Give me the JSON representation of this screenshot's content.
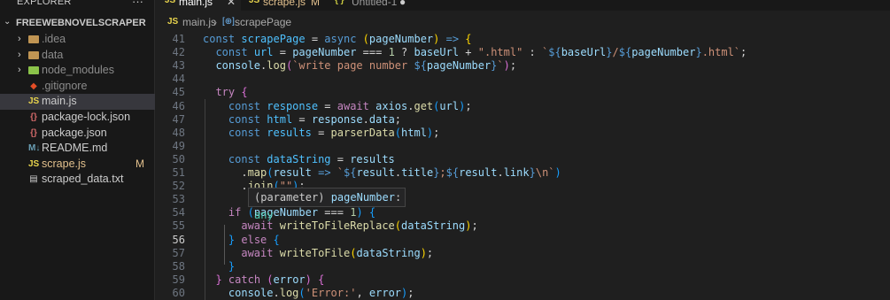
{
  "sidebar": {
    "title": "EXPLORER",
    "more": "···",
    "folder": {
      "chevron": "⌄",
      "name": "FREEWEBNOVELSCRAPER"
    },
    "items": [
      {
        "name": ".idea",
        "type": "folder",
        "icon": "folder-icon",
        "chevron": "›",
        "color": "gray",
        "iconColor": "#c09553"
      },
      {
        "name": "data",
        "type": "folder",
        "icon": "folder-icon",
        "chevron": "›",
        "color": "gray",
        "iconColor": "#c09553"
      },
      {
        "name": "node_modules",
        "type": "folder",
        "icon": "folder-icon",
        "chevron": "›",
        "color": "gray",
        "iconColor": "#8bc34a"
      },
      {
        "name": ".gitignore",
        "type": "file",
        "icon": "git-icon",
        "chevron": "",
        "color": "gray"
      },
      {
        "name": "main.js",
        "type": "file",
        "icon": "js-icon",
        "chevron": "",
        "color": "normal",
        "active": true
      },
      {
        "name": "package-lock.json",
        "type": "file",
        "icon": "json-icon",
        "chevron": "",
        "color": "normal"
      },
      {
        "name": "package.json",
        "type": "file",
        "icon": "json-icon",
        "chevron": "",
        "color": "normal"
      },
      {
        "name": "README.md",
        "type": "file",
        "icon": "markdown-icon",
        "chevron": "",
        "color": "normal"
      },
      {
        "name": "scrape.js",
        "type": "file",
        "icon": "js-icon",
        "chevron": "",
        "color": "modified",
        "badge": "M"
      },
      {
        "name": "scraped_data.txt",
        "type": "file",
        "icon": "text-file-icon",
        "chevron": "",
        "color": "normal"
      }
    ]
  },
  "tabs": [
    {
      "label": "main.js",
      "icon": "JS",
      "active": true,
      "close": "✕"
    },
    {
      "label": "scrape.js",
      "icon": "JS",
      "badge": "M",
      "active": false
    },
    {
      "label": "Untitled-1",
      "icon": "{ }",
      "dirty": "●",
      "active": false
    }
  ],
  "breadcrumb": {
    "file_icon": "JS",
    "file": "main.js",
    "sep": "›",
    "symbol_icon": "[⊕]",
    "symbol": "scrapePage"
  },
  "editor": {
    "current_line": 56,
    "lines": [
      {
        "n": 41,
        "tokens": [
          [
            "kw",
            "const "
          ],
          [
            "cst",
            "scrapePage"
          ],
          [
            "pn",
            " = "
          ],
          [
            "kw",
            "async "
          ],
          [
            "br1",
            "("
          ],
          [
            "var",
            "pageNumber"
          ],
          [
            "br1",
            ")"
          ],
          [
            "pn",
            " "
          ],
          [
            "kw",
            "=>"
          ],
          [
            "pn",
            " "
          ],
          [
            "br1",
            "{"
          ]
        ]
      },
      {
        "n": 42,
        "tokens": [
          [
            "pn",
            "  "
          ],
          [
            "kw",
            "const "
          ],
          [
            "cst",
            "url"
          ],
          [
            "pn",
            " = "
          ],
          [
            "var",
            "pageNumber"
          ],
          [
            "pn",
            " === "
          ],
          [
            "num",
            "1"
          ],
          [
            "pn",
            " ? "
          ],
          [
            "var",
            "baseUrl"
          ],
          [
            "pn",
            " + "
          ],
          [
            "str",
            "\".html\""
          ],
          [
            "pn",
            " : "
          ],
          [
            "str",
            "`"
          ],
          [
            "kw",
            "${"
          ],
          [
            "var",
            "baseUrl"
          ],
          [
            "kw",
            "}"
          ],
          [
            "str",
            "/"
          ],
          [
            "kw",
            "${"
          ],
          [
            "var",
            "pageNumber"
          ],
          [
            "kw",
            "}"
          ],
          [
            "str",
            ".html`"
          ],
          [
            "pn",
            ";"
          ]
        ]
      },
      {
        "n": 43,
        "tokens": [
          [
            "pn",
            "  "
          ],
          [
            "var",
            "console"
          ],
          [
            "pn",
            "."
          ],
          [
            "fn",
            "log"
          ],
          [
            "br2",
            "("
          ],
          [
            "str",
            "`write page number "
          ],
          [
            "kw",
            "${"
          ],
          [
            "var",
            "pageNumber"
          ],
          [
            "kw",
            "}"
          ],
          [
            "str",
            "`"
          ],
          [
            "br2",
            ")"
          ],
          [
            "pn",
            ";"
          ]
        ]
      },
      {
        "n": 44,
        "tokens": []
      },
      {
        "n": 45,
        "tokens": [
          [
            "pn",
            "  "
          ],
          [
            "ctl",
            "try"
          ],
          [
            "pn",
            " "
          ],
          [
            "br2",
            "{"
          ]
        ]
      },
      {
        "n": 46,
        "tokens": [
          [
            "pn",
            "    "
          ],
          [
            "kw",
            "const "
          ],
          [
            "cst",
            "response"
          ],
          [
            "pn",
            " = "
          ],
          [
            "ctl",
            "await "
          ],
          [
            "var",
            "axios"
          ],
          [
            "pn",
            "."
          ],
          [
            "fn",
            "get"
          ],
          [
            "br3",
            "("
          ],
          [
            "var",
            "url"
          ],
          [
            "br3",
            ")"
          ],
          [
            "pn",
            ";"
          ]
        ]
      },
      {
        "n": 47,
        "tokens": [
          [
            "pn",
            "    "
          ],
          [
            "kw",
            "const "
          ],
          [
            "cst",
            "html"
          ],
          [
            "pn",
            " = "
          ],
          [
            "var",
            "response"
          ],
          [
            "pn",
            "."
          ],
          [
            "var",
            "data"
          ],
          [
            "pn",
            ";"
          ]
        ]
      },
      {
        "n": 48,
        "tokens": [
          [
            "pn",
            "    "
          ],
          [
            "kw",
            "const "
          ],
          [
            "cst",
            "results"
          ],
          [
            "pn",
            " = "
          ],
          [
            "fn",
            "parserData"
          ],
          [
            "br3",
            "("
          ],
          [
            "var",
            "html"
          ],
          [
            "br3",
            ")"
          ],
          [
            "pn",
            ";"
          ]
        ]
      },
      {
        "n": 49,
        "tokens": []
      },
      {
        "n": 50,
        "tokens": [
          [
            "pn",
            "    "
          ],
          [
            "kw",
            "const "
          ],
          [
            "cst",
            "dataString"
          ],
          [
            "pn",
            " = "
          ],
          [
            "var",
            "results"
          ]
        ]
      },
      {
        "n": 51,
        "tokens": [
          [
            "pn",
            "      ."
          ],
          [
            "fn",
            "map"
          ],
          [
            "br3",
            "("
          ],
          [
            "var",
            "result"
          ],
          [
            "pn",
            " "
          ],
          [
            "kw",
            "=>"
          ],
          [
            "pn",
            " "
          ],
          [
            "str",
            "`"
          ],
          [
            "kw",
            "${"
          ],
          [
            "var",
            "result"
          ],
          [
            "pn",
            "."
          ],
          [
            "var",
            "title"
          ],
          [
            "kw",
            "}"
          ],
          [
            "str",
            ";"
          ],
          [
            "kw",
            "${"
          ],
          [
            "var",
            "result"
          ],
          [
            "pn",
            "."
          ],
          [
            "var",
            "link"
          ],
          [
            "kw",
            "}"
          ],
          [
            "str",
            "\\n`"
          ],
          [
            "br3",
            ")"
          ]
        ]
      },
      {
        "n": 52,
        "tokens": [
          [
            "pn",
            "      ."
          ],
          [
            "fn",
            "join"
          ],
          [
            "br3",
            "("
          ],
          [
            "str",
            "\"\""
          ],
          [
            "br3",
            ")"
          ],
          [
            "pn",
            ";"
          ]
        ]
      },
      {
        "n": 53,
        "tokens": []
      },
      {
        "n": 54,
        "tokens": [
          [
            "pn",
            "    "
          ],
          [
            "ctl",
            "if"
          ],
          [
            "pn",
            " "
          ],
          [
            "br3",
            "("
          ],
          [
            "var",
            "pageNumber"
          ],
          [
            "pn",
            " === "
          ],
          [
            "num",
            "1"
          ],
          [
            "br3",
            ")"
          ],
          [
            "pn",
            " "
          ],
          [
            "br3",
            "{"
          ]
        ]
      },
      {
        "n": 55,
        "tokens": [
          [
            "pn",
            "      "
          ],
          [
            "ctl",
            "await "
          ],
          [
            "fn",
            "writeToFileReplace"
          ],
          [
            "br1",
            "("
          ],
          [
            "var",
            "dataString"
          ],
          [
            "br1",
            ")"
          ],
          [
            "pn",
            ";"
          ]
        ]
      },
      {
        "n": 56,
        "tokens": [
          [
            "pn",
            "    "
          ],
          [
            "br3",
            "}"
          ],
          [
            "pn",
            " "
          ],
          [
            "ctl",
            "else"
          ],
          [
            "pn",
            " "
          ],
          [
            "br3",
            "{"
          ]
        ]
      },
      {
        "n": 57,
        "tokens": [
          [
            "pn",
            "      "
          ],
          [
            "ctl",
            "await "
          ],
          [
            "fn",
            "writeToFile"
          ],
          [
            "br1",
            "("
          ],
          [
            "var",
            "dataString"
          ],
          [
            "br1",
            ")"
          ],
          [
            "pn",
            ";"
          ]
        ]
      },
      {
        "n": 58,
        "tokens": [
          [
            "pn",
            "    "
          ],
          [
            "br3",
            "}"
          ]
        ]
      },
      {
        "n": 59,
        "tokens": [
          [
            "pn",
            "  "
          ],
          [
            "br2",
            "}"
          ],
          [
            "pn",
            " "
          ],
          [
            "ctl",
            "catch"
          ],
          [
            "pn",
            " "
          ],
          [
            "br2",
            "("
          ],
          [
            "var",
            "error"
          ],
          [
            "br2",
            ")"
          ],
          [
            "pn",
            " "
          ],
          [
            "br2",
            "{"
          ]
        ]
      },
      {
        "n": 60,
        "tokens": [
          [
            "pn",
            "    "
          ],
          [
            "var",
            "console"
          ],
          [
            "pn",
            "."
          ],
          [
            "fn",
            "log"
          ],
          [
            "br3",
            "("
          ],
          [
            "str",
            "'Error:'"
          ],
          [
            "pn",
            ", "
          ],
          [
            "var",
            "error"
          ],
          [
            "br3",
            ")"
          ],
          [
            "pn",
            ";"
          ]
        ]
      }
    ]
  },
  "hover": {
    "prefix": "(parameter) ",
    "name": "pageNumber",
    "sep": ": ",
    "type": "any"
  }
}
